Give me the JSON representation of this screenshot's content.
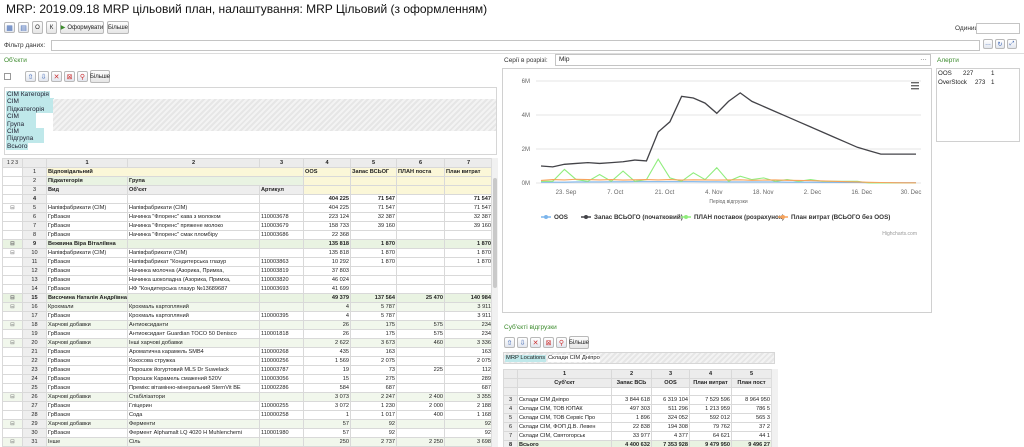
{
  "title": "MRP: 2019.09.18 MRP цільовий план, налаштування: MRP Цільовий (з оформленням)",
  "toolbar": {
    "btn_o": "О",
    "btn_k": "К",
    "form_label": "Оформувати",
    "more": "Більше",
    "unit_label": "Одиниця"
  },
  "filter": {
    "label": "Фільтр даних:"
  },
  "objects": {
    "label": "Об'єкти",
    "more": "Більше",
    "chips": [
      "СІМ Категорія",
      "СІМ Підкатегорія",
      "СІМ Група",
      "СІМ Підгрупа",
      "Всього"
    ]
  },
  "series": {
    "label": "Серії в розрізі:",
    "value": "Мір"
  },
  "alerts": {
    "label": "Алерти",
    "rows": [
      {
        "name": "OOS",
        "count": "227",
        "n": "1"
      },
      {
        "name": "OverStock",
        "count": "273",
        "n": "1"
      }
    ]
  },
  "chart_data": {
    "type": "line",
    "xlabel": "Період відгрузки",
    "ytick_labels": [
      "0M",
      "2M",
      "4M",
      "6M"
    ],
    "ylim": [
      0,
      6000000
    ],
    "x_ticks": [
      "23. Sep",
      "7. Oct",
      "21. Oct",
      "4. Nov",
      "18. Nov",
      "2. Dec",
      "16. Dec",
      "30. Dec"
    ],
    "series": [
      {
        "name": "OOS",
        "color": "#7cb5ec",
        "values": [
          50000,
          50000,
          50000,
          60000,
          60000,
          60000,
          70000,
          70000,
          80000,
          80000,
          80000,
          80000,
          80000,
          80000,
          70000,
          70000,
          60000,
          60000,
          60000,
          60000,
          60000,
          50000,
          50000,
          50000,
          40000,
          40000,
          30000,
          30000,
          20000,
          20000,
          20000,
          20000,
          20000
        ]
      },
      {
        "name": "Запас ВСЬОГО (початковий)",
        "color": "#434348",
        "values": [
          1000000,
          950000,
          1100000,
          1150000,
          1200000,
          1150000,
          1200000,
          1250000,
          1350000,
          1300000,
          3000000,
          3600000,
          5100000,
          5000000,
          4700000,
          4100000,
          4800000,
          5300000,
          4800000,
          4500000,
          4200000,
          3900000,
          3600000,
          3300000,
          3000000,
          2700000,
          2400000,
          2100000,
          1900000,
          1700000,
          1700000,
          1700000,
          1700000
        ]
      },
      {
        "name": "ПЛАН поставок (розрахунок)",
        "color": "#90ed7d",
        "values": [
          100000,
          100000,
          800000,
          200000,
          100000,
          500000,
          100000,
          700000,
          100000,
          200000,
          1400000,
          300000,
          100000,
          600000,
          200000,
          900000,
          100000,
          400000,
          200000,
          300000,
          100000,
          200000,
          100000,
          200000,
          100000,
          100000,
          100000,
          100000,
          0,
          0,
          0,
          0,
          0
        ]
      },
      {
        "name": "План витрат (ВСЬОГО без ООS)",
        "color": "#f7a35c",
        "values": [
          150000,
          200000,
          180000,
          220000,
          200000,
          180000,
          200000,
          170000,
          190000,
          200000,
          180000,
          200000,
          170000,
          190000,
          180000,
          170000,
          180000,
          190000,
          160000,
          170000,
          180000,
          160000,
          150000,
          140000,
          120000,
          100000,
          80000,
          60000,
          40000,
          30000,
          20000,
          10000,
          10000
        ]
      }
    ],
    "credits": "Highcharts.com"
  },
  "sub": {
    "label": "Суб'єкті відгрузки",
    "more": "Більше",
    "loc_tag": "MRP Locations",
    "loc_text": "Склади СІМ Дніпро",
    "head_nums": [
      "1",
      "2",
      "3",
      "4",
      "5"
    ],
    "head": [
      "Суб'єкт",
      "Запас ВСЬ",
      "OOS",
      "План витрат",
      "План пост"
    ],
    "rows": [
      {
        "n": "",
        "c": [
          "",
          "",
          "",
          "",
          ""
        ]
      },
      {
        "n": "3",
        "c": [
          "Склади СІМ Дніпро",
          "3 844 618",
          "6 319 104",
          "7 529 596",
          "8 964 950"
        ]
      },
      {
        "n": "4",
        "c": [
          "Склади СІМ, ТОВ ЮПАК",
          "497 303",
          "511 296",
          "1 213 959",
          "786 5"
        ]
      },
      {
        "n": "5",
        "c": [
          "Склади СІМ, ТОВ Сервіс Про",
          "1 896",
          "324 052",
          "592 012",
          "565 3"
        ]
      },
      {
        "n": "6",
        "c": [
          "Склади СІМ, ФОП Д.В. Левен",
          "22 838",
          "194 308",
          "79 762",
          "37 2"
        ]
      },
      {
        "n": "7",
        "c": [
          "Склади СІМ, Святогорськ",
          "33 977",
          "4 377",
          "64 621",
          "44 1"
        ]
      },
      {
        "n": "8",
        "c": [
          "Всього",
          "4 400 632",
          "7 353 928",
          "9 479 950",
          "9 496 27"
        ]
      }
    ]
  },
  "main": {
    "colnums": [
      "1",
      "2",
      "3",
      "4",
      "5",
      "6",
      "7"
    ],
    "head1": [
      "Відповідальний",
      "",
      "",
      "OOS",
      "Запас ВСЬОГ",
      "ПЛАН поста",
      "План витрат"
    ],
    "head2": [
      "Підкатегорія",
      "Група"
    ],
    "head3": [
      "Вид",
      "Об'єкт",
      "Артикул"
    ],
    "rows": [
      {
        "n": "4",
        "cls": "bold",
        "a": "",
        "b": "",
        "c": "",
        "v": [
          "404 225",
          "71 547",
          "",
          "71 547"
        ]
      },
      {
        "n": "5",
        "cls": "",
        "a": "Напівфабрикати (СІМ)",
        "b": "Напівфабрикати (СІМ)",
        "c": "",
        "v": [
          "404 225",
          "71 547",
          "",
          "71 547"
        ]
      },
      {
        "n": "6",
        "cls": "",
        "a": "ГрВзаєм",
        "b": "Начинка \"Флоренс\" кава з молоком",
        "c": "110003678",
        "v": [
          "223 124",
          "32 387",
          "",
          "32 387"
        ]
      },
      {
        "n": "7",
        "cls": "",
        "a": "ГрВзаєм",
        "b": "Начинка \"Флоренс\" пряжене молоко",
        "c": "110003679",
        "v": [
          "158 733",
          "39 160",
          "",
          "39 160"
        ]
      },
      {
        "n": "8",
        "cls": "",
        "a": "ГрВзаєм",
        "b": "Начинка \"Флоренс\" смак пломбіру",
        "c": "110003686",
        "v": [
          "22 368",
          "",
          "",
          ""
        ]
      },
      {
        "n": "9",
        "cls": "bold gr",
        "a": "Вежвина Віра Віталіївна",
        "b": "",
        "c": "",
        "v": [
          "135 818",
          "1 870",
          "",
          "1 870"
        ]
      },
      {
        "n": "10",
        "cls": "",
        "a": "Напівфабрикати (СІМ)",
        "b": "Напівфабрикати (СІМ)",
        "c": "",
        "v": [
          "135 818",
          "1 870",
          "",
          "1 870"
        ]
      },
      {
        "n": "11",
        "cls": "",
        "a": "ГрВзаєм",
        "b": "Напівфабрикат \"Кондитерська глазур",
        "c": "110003863",
        "v": [
          "10 292",
          "1 870",
          "",
          "1 870"
        ]
      },
      {
        "n": "12",
        "cls": "",
        "a": "ГрВзаєм",
        "b": "Начинка молочна (Азорика, Примха,",
        "c": "110003819",
        "v": [
          "37 803",
          "",
          "",
          ""
        ]
      },
      {
        "n": "13",
        "cls": "",
        "a": "ГрВзаєм",
        "b": "Начинка шоколадна (Азорика, Примха,",
        "c": "110003820",
        "v": [
          "46 024",
          "",
          "",
          ""
        ]
      },
      {
        "n": "14",
        "cls": "",
        "a": "ГрВзаєм",
        "b": "НФ \"Кондитерська глазур №13689687",
        "c": "110003693",
        "v": [
          "41 699",
          "",
          "",
          ""
        ]
      },
      {
        "n": "15",
        "cls": "bold gr",
        "a": "Височина Наталія Андріївна",
        "b": "",
        "c": "",
        "v": [
          "49 379",
          "137 564",
          "25 470",
          "140 984"
        ]
      },
      {
        "n": "16",
        "cls": "gr2",
        "a": "Крохмали",
        "b": "Крохмаль картопляний",
        "c": "",
        "v": [
          "4",
          "5 787",
          "",
          "3 911"
        ]
      },
      {
        "n": "17",
        "cls": "",
        "a": "ГрВзаєм",
        "b": "Крохмаль картопляний",
        "c": "110000395",
        "v": [
          "4",
          "5 787",
          "",
          "3 911"
        ]
      },
      {
        "n": "18",
        "cls": "gr2",
        "a": "Харчові добавки",
        "b": "Антиоксиданти",
        "c": "",
        "v": [
          "26",
          "175",
          "575",
          "234"
        ]
      },
      {
        "n": "19",
        "cls": "",
        "a": "ГрВзаєм",
        "b": "Антиоксидант Guardian TOCO 50 Denisco",
        "c": "110001818",
        "v": [
          "26",
          "175",
          "575",
          "234"
        ]
      },
      {
        "n": "20",
        "cls": "gr2",
        "a": "Харчові добавки",
        "b": "Інші харчові добавки",
        "c": "",
        "v": [
          "2 622",
          "3 673",
          "460",
          "3 336"
        ]
      },
      {
        "n": "21",
        "cls": "",
        "a": "ГрВзаєм",
        "b": "Ароматична карамель SMB4",
        "c": "110000268",
        "v": [
          "435",
          "163",
          "",
          "163"
        ]
      },
      {
        "n": "22",
        "cls": "",
        "a": "ГрВзаєм",
        "b": "Кокосова стружка",
        "c": "110000256",
        "v": [
          "1 569",
          "2 075",
          "",
          "2 075"
        ]
      },
      {
        "n": "23",
        "cls": "",
        "a": "ГрВзаєм",
        "b": "Порошок йогуртовий MLS Dr Suwelack",
        "c": "110003787",
        "v": [
          "19",
          "73",
          "225",
          "112"
        ]
      },
      {
        "n": "24",
        "cls": "",
        "a": "ГрВзаєм",
        "b": "Порошок Карамель смажений 520V",
        "c": "110003056",
        "v": [
          "15",
          "275",
          "",
          "289"
        ]
      },
      {
        "n": "25",
        "cls": "",
        "a": "ГрВзаєм",
        "b": "Премікс вітамінно-мінеральний SternVit BE",
        "c": "110002286",
        "v": [
          "584",
          "687",
          "",
          "687"
        ]
      },
      {
        "n": "26",
        "cls": "gr2",
        "a": "Харчові добавки",
        "b": "Стабілізатори",
        "c": "",
        "v": [
          "3 073",
          "2 247",
          "2 400",
          "3 355"
        ]
      },
      {
        "n": "27",
        "cls": "",
        "a": "ГрВзаєм",
        "b": "Гліцерин",
        "c": "110000255",
        "v": [
          "3 072",
          "1 230",
          "2 000",
          "2 188"
        ]
      },
      {
        "n": "28",
        "cls": "",
        "a": "ГрВзаєм",
        "b": "Сода",
        "c": "110000258",
        "v": [
          "1",
          "1 017",
          "400",
          "1 168"
        ]
      },
      {
        "n": "29",
        "cls": "gr2",
        "a": "Харчові добавки",
        "b": "Ферменти",
        "c": "",
        "v": [
          "57",
          "92",
          "",
          "92"
        ]
      },
      {
        "n": "30",
        "cls": "",
        "a": "ГрВзаєм",
        "b": "Фермент Alphamalt LQ 4020 H Muhlenchemi",
        "c": "110001980",
        "v": [
          "57",
          "92",
          "",
          "92"
        ]
      },
      {
        "n": "31",
        "cls": "gr2",
        "a": "Інше",
        "b": "Сіль",
        "c": "",
        "v": [
          "250",
          "2 737",
          "2 250",
          "3 698"
        ]
      },
      {
        "n": "32",
        "cls": "",
        "a": "ГрВзаєм",
        "b": "Сіль Екстра",
        "c": "110000259",
        "v": [
          "250",
          "2 737",
          "2 250",
          "3 698"
        ]
      },
      {
        "n": "33",
        "cls": "gr2",
        "a": "Сахаристі",
        "b": "Патока глюкозна",
        "c": "",
        "v": [
          "31 287",
          "78 188",
          "",
          "78 188"
        ]
      }
    ]
  }
}
